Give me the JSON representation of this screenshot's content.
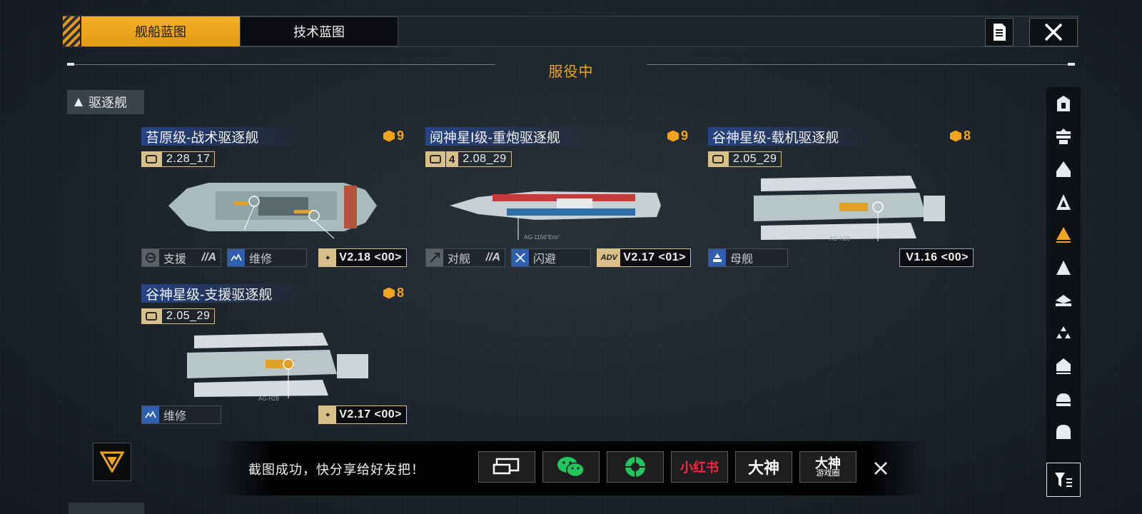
{
  "tabs": [
    {
      "label": "舰船蓝图",
      "active": true
    },
    {
      "label": "技术蓝图",
      "active": false
    }
  ],
  "section_title": "服役中",
  "category": {
    "label": "驱逐舰"
  },
  "ships": [
    {
      "name": "苔原级-战术驱逐舰",
      "cost": "9",
      "stat_badge": "",
      "stat_value": "2.28_17",
      "roles": [
        {
          "label": "支援",
          "grade": "//A",
          "icon": "support-icon"
        },
        {
          "label": "维修",
          "grade": "",
          "icon": "repair-icon"
        }
      ],
      "version": "V2.18 <00>",
      "version_badge": "star"
    },
    {
      "name": "阋神星Ⅰ级-重炮驱逐舰",
      "cost": "9",
      "stat_badge": "4",
      "stat_value": "2.08_29",
      "ship_label": "AG-1156\"Eris\"",
      "roles": [
        {
          "label": "对舰",
          "grade": "//A",
          "icon": "anti-ship-icon"
        },
        {
          "label": "闪避",
          "grade": "",
          "icon": "evade-icon"
        }
      ],
      "version": "V2.17 <01>",
      "version_badge": "ADV"
    },
    {
      "name": "谷神星级-载机驱逐舰",
      "cost": "8",
      "stat_badge": "",
      "stat_value": "2.05_29",
      "ship_label": "AG-H28",
      "roles": [
        {
          "label": "母舰",
          "grade": "",
          "icon": "carrier-icon"
        }
      ],
      "version": "V1.16 <00>",
      "version_badge": ""
    },
    {
      "name": "谷神星级-支援驱逐舰",
      "cost": "8",
      "stat_badge": "",
      "stat_value": "2.05_29",
      "ship_label": "AG-H28",
      "roles": [
        {
          "label": "维修",
          "grade": "",
          "icon": "repair-icon"
        }
      ],
      "version": "V2.17 <00>",
      "version_badge": "star"
    }
  ],
  "toast": {
    "message": "截图成功，快分享给好友把！",
    "share_targets": [
      "screenshot",
      "wechat",
      "moments",
      "小红书",
      "大神",
      "大神 游戏圈"
    ]
  },
  "share": {
    "xiaohongshu": "小红书",
    "dashen": "大神",
    "dashen_top": "大神",
    "dashen_bottom": "游戏圈"
  },
  "colors": {
    "accent": "#f0a51c",
    "title_band": "#26468c",
    "badge_gold": "#d9c08a",
    "xhs_red": "#ff2442"
  }
}
